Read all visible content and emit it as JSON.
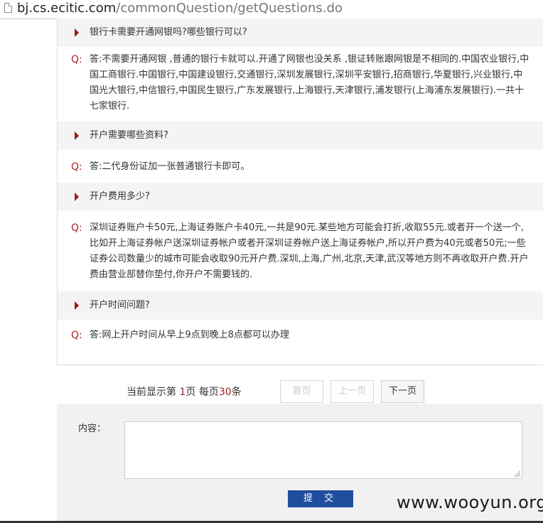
{
  "address_bar": {
    "host": "bj.cs.ecitic.com",
    "path": "/commonQuestion/getQuestions.do",
    "icon": "page-icon"
  },
  "faq": [
    {
      "question": "银行卡需要开通网银吗?哪些银行可以?",
      "answer_marker": "Q:",
      "answer": "答:不需要开通网银 ,普通的银行卡就可以.开通了网银也没关系 ,银证转账跟网银是不相同的.中国农业银行,中国工商银行.中国银行,中国建设银行,交通银行,深圳发展银行,深圳平安银行,招商银行,华夏银行,兴业银行,中国光大银行,中信银行,中国民生银行,广东发展银行,上海银行,天津银行,浦发银行(上海浦东发展银行).一共十七家银行."
    },
    {
      "question": "开户需要哪些资料?",
      "answer_marker": "Q:",
      "answer": "答:二代身份证加一张普通银行卡即可。"
    },
    {
      "question": "开户费用多少?",
      "answer_marker": "Q:",
      "answer": "深圳证券账户卡50元,上海证券账户卡40元,一共是90元.某些地方可能会打折,收取55元.或者开一个送一个,比如开上海证券帐户送深圳证券帐户或者开深圳证券帐户送上海证券帐户,所以开户费为40元或者50元;一些证券公司数量少的城市可能会收取90元开户费.深圳,上海,广州,北京,天津,武汉等地方则不再收取开户费.开户费由营业部替你垫付,你开户不需要钱的."
    },
    {
      "question": "开户时间问题?",
      "answer_marker": "Q:",
      "answer": "答:网上开户时间从早上9点到晚上8点都可以办理"
    }
  ],
  "pagination": {
    "prefix": "当前显示第 ",
    "current_page": "1",
    "middle": "页 每页",
    "per_page": "30",
    "suffix": "条",
    "first_label": "首页",
    "prev_label": "上一页",
    "next_label": "下一页"
  },
  "comment": {
    "label": "内容：",
    "value": "",
    "submit_label": "提 交"
  },
  "watermark": "www.wooyun.org",
  "colors": {
    "accent_red": "#9b1b1b",
    "submit_blue": "#1f4e9c",
    "row_bg": "#f4f4f4"
  }
}
